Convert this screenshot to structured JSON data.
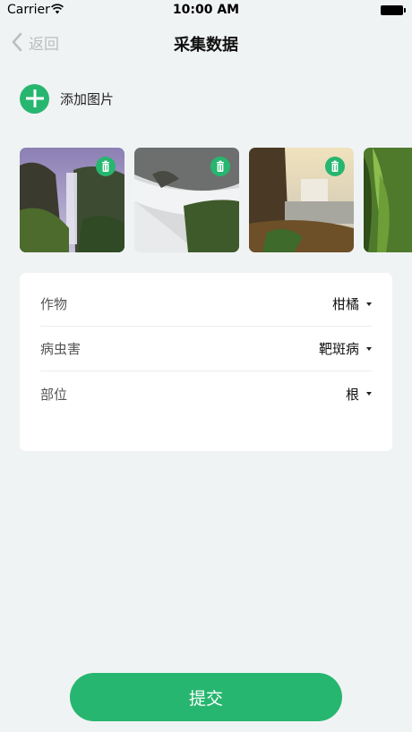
{
  "status_bar": {
    "carrier": "Carrier",
    "time": "10:00 AM"
  },
  "nav": {
    "back_label": "返回",
    "title": "采集数据"
  },
  "add_image": {
    "label": "添加图片",
    "icon": "plus-circle-icon"
  },
  "photos": [
    {
      "name": "waterfall-cliff",
      "has_delete": true
    },
    {
      "name": "river-rapids",
      "has_delete": true
    },
    {
      "name": "waterfall-lake",
      "has_delete": true
    },
    {
      "name": "green-foliage",
      "has_delete": false
    }
  ],
  "form": {
    "rows": [
      {
        "label": "作物",
        "value": "柑橘"
      },
      {
        "label": "病虫害",
        "value": "靶斑病"
      },
      {
        "label": "部位",
        "value": "根"
      }
    ]
  },
  "submit": {
    "label": "提交"
  },
  "colors": {
    "accent": "#27b66f",
    "background": "#f0f3f4"
  }
}
